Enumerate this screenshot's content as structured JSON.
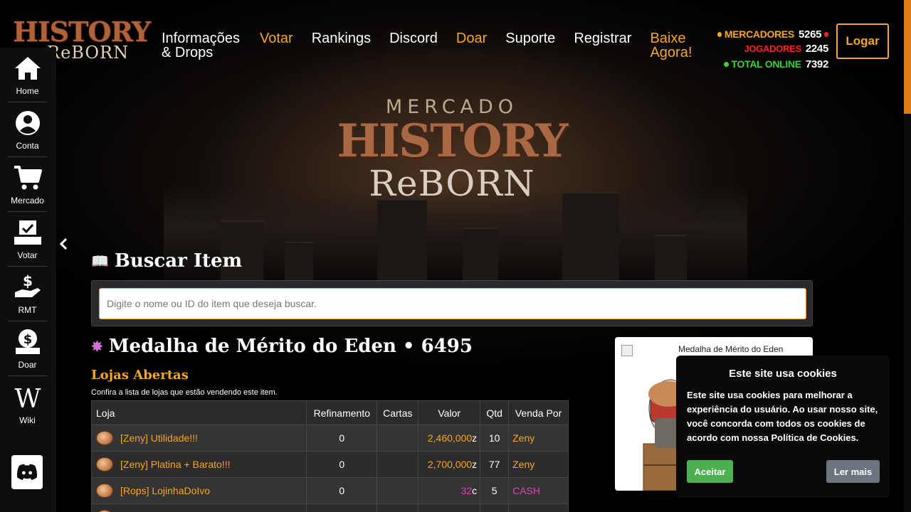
{
  "logo": {
    "top": "HISTORY",
    "bottom": "ReBORN"
  },
  "nav": [
    {
      "label": "Informações & Drops",
      "color": "#ffffff"
    },
    {
      "label": "Votar",
      "color": "#f5a623"
    },
    {
      "label": "Rankings",
      "color": "#ffffff"
    },
    {
      "label": "Discord",
      "color": "#ffffff"
    },
    {
      "label": "Doar",
      "color": "#f5a623"
    },
    {
      "label": "Suporte",
      "color": "#ffffff"
    },
    {
      "label": "Registrar",
      "color": "#ffffff"
    },
    {
      "label": "Baixe Agora!",
      "color": "#f5a623"
    }
  ],
  "stats": {
    "mercadores_label": "MERCADORES",
    "mercadores_value": "5265",
    "jogadores_label": "JOGADORES",
    "jogadores_value": "2245",
    "total_label": "TOTAL ONLINE",
    "total_value": "7392",
    "colors": {
      "mercadores": "#f5a623",
      "jogadores": "#ff2020",
      "total": "#3bd13b"
    }
  },
  "login_label": "Logar",
  "sidebar": [
    {
      "label": "Home",
      "icon": "home-icon"
    },
    {
      "label": "Conta",
      "icon": "user-icon"
    },
    {
      "label": "Mercado",
      "icon": "cart-icon"
    },
    {
      "label": "Votar",
      "icon": "vote-icon"
    },
    {
      "label": "RMT",
      "icon": "money-hand-icon"
    },
    {
      "label": "Doar",
      "icon": "donate-icon"
    },
    {
      "label": "Wiki",
      "icon": "wikipedia-icon"
    }
  ],
  "hero": {
    "small": "MERCADO",
    "big": "HISTORY",
    "reborn": "ReBORN"
  },
  "search": {
    "title": "Buscar Item",
    "placeholder": "Digite o nome ou ID do item que deseja buscar."
  },
  "item": {
    "title": "Medalha de Mérito do Eden • 6495",
    "card_title": "Medalha de Mérito do Eden"
  },
  "shops": {
    "title": "Lojas Abertas",
    "subtitle": "Confira a lista de lojas que estão vendendo este item.",
    "headers": [
      "Loja",
      "Refinamento",
      "Cartas",
      "Valor",
      "Qtd",
      "Venda Por"
    ],
    "rows": [
      {
        "name": "[Zeny] Utilidade!!!",
        "refine": "0",
        "cards": "",
        "value": "2,460,000",
        "suffix": "z",
        "qty": "10",
        "sell": "Zeny",
        "type": "zeny"
      },
      {
        "name": "[Zeny] Platina + Barato!!!",
        "refine": "0",
        "cards": "",
        "value": "2,700,000",
        "suffix": "z",
        "qty": "77",
        "sell": "Zeny",
        "type": "zeny"
      },
      {
        "name": "[Rops] LojinhaDoIvo",
        "refine": "0",
        "cards": "",
        "value": "32",
        "suffix": "c",
        "qty": "5",
        "sell": "CASH",
        "type": "cash"
      }
    ]
  },
  "cookie": {
    "title": "Este site usa cookies",
    "text": "Este site usa cookies para melhorar a experiência do usuário. Ao usar nosso site, você concorda com todos os cookies de acordo com nossa Política de Cookies.",
    "accept": "Aceitar",
    "more": "Ler mais"
  }
}
